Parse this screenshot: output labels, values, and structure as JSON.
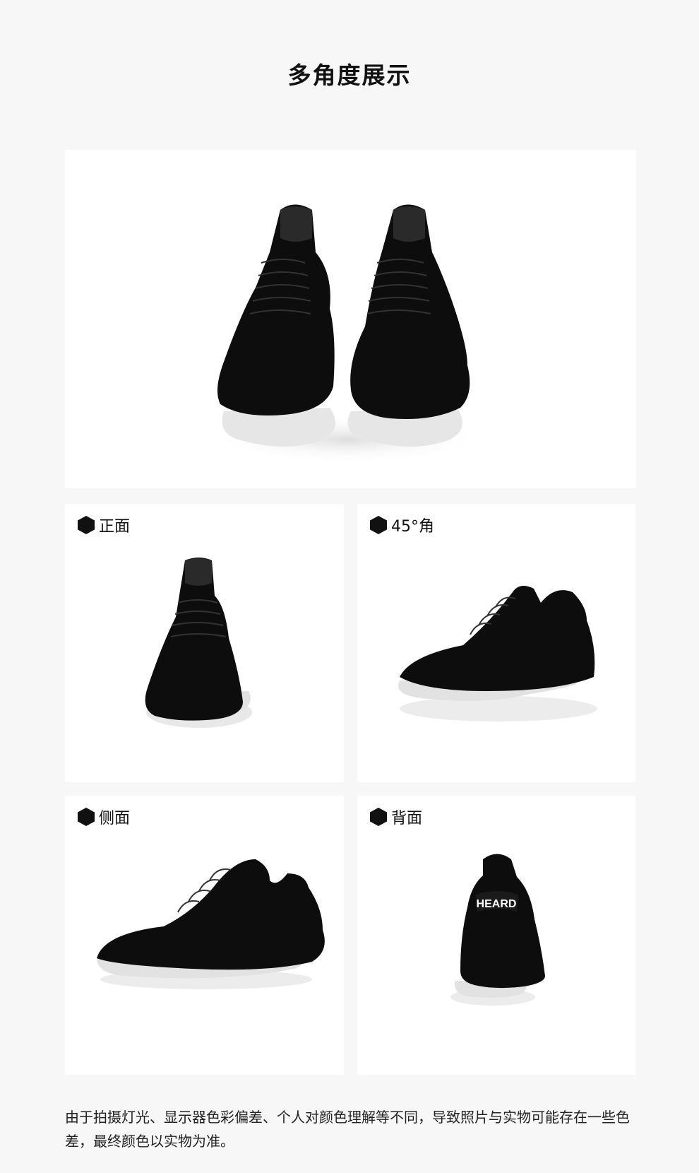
{
  "page": {
    "title": "多角度展示",
    "note": "由于拍摄灯光、显示器色彩偏差、个人对颜色理解等不同，导致照片与实物可能存在一些色差，最终颜色以实物为准。"
  },
  "panels": [
    {
      "label": "正面",
      "icon": "hexagon-icon"
    },
    {
      "label": "45°角",
      "icon": "hexagon-icon"
    },
    {
      "label": "侧面",
      "icon": "hexagon-icon"
    },
    {
      "label": "背面",
      "icon": "hexagon-icon"
    }
  ],
  "back_logo_text": "HEARD",
  "colors": {
    "background": "#f7f7f7",
    "panel": "#ffffff",
    "shoe": "#0d0d0d",
    "sole": "#e6e6e6"
  }
}
